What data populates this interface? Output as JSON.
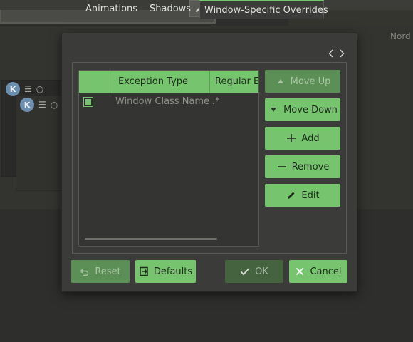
{
  "background": {
    "label_right": "Nord",
    "kde_glyph": "K"
  },
  "dialog": {
    "tabs": [
      {
        "label": "Animations",
        "active": false
      },
      {
        "label": "Shadows",
        "active": false
      },
      {
        "label": "Window-Specific Overrides",
        "active": true
      }
    ],
    "tab_scroll": {
      "left_icon": "chevron-left-icon",
      "right_icon": "chevron-right-icon"
    },
    "table": {
      "columns": [
        "",
        "Exception Type",
        "Regular Ex"
      ],
      "rows": [
        {
          "checked": true,
          "type": "Window Class Name",
          "regex": ".*"
        }
      ]
    },
    "side_buttons": {
      "move_up": {
        "label": "Move Up",
        "icon": "triangle-up-icon",
        "enabled": false
      },
      "move_down": {
        "label": "Move Down",
        "icon": "triangle-down-icon",
        "enabled": true
      },
      "add": {
        "label": "Add",
        "icon": "plus-icon",
        "enabled": true
      },
      "remove": {
        "label": "Remove",
        "icon": "minus-icon",
        "enabled": true
      },
      "edit": {
        "label": "Edit",
        "icon": "pencil-icon",
        "enabled": true
      }
    },
    "footer": {
      "reset": {
        "label": "Reset",
        "icon": "undo-icon",
        "enabled": false
      },
      "defaults": {
        "label": "Defaults",
        "icon": "defaults-icon",
        "enabled": true
      },
      "ok": {
        "label": "OK",
        "icon": "checkmark-icon",
        "enabled": false
      },
      "cancel": {
        "label": "Cancel",
        "icon": "close-icon",
        "enabled": true
      }
    }
  },
  "colors": {
    "accent": "#76c46e",
    "accent_disabled": "#5c8f55",
    "dialog_bg": "#3b3c39",
    "backdrop": "#2e2f2c"
  }
}
